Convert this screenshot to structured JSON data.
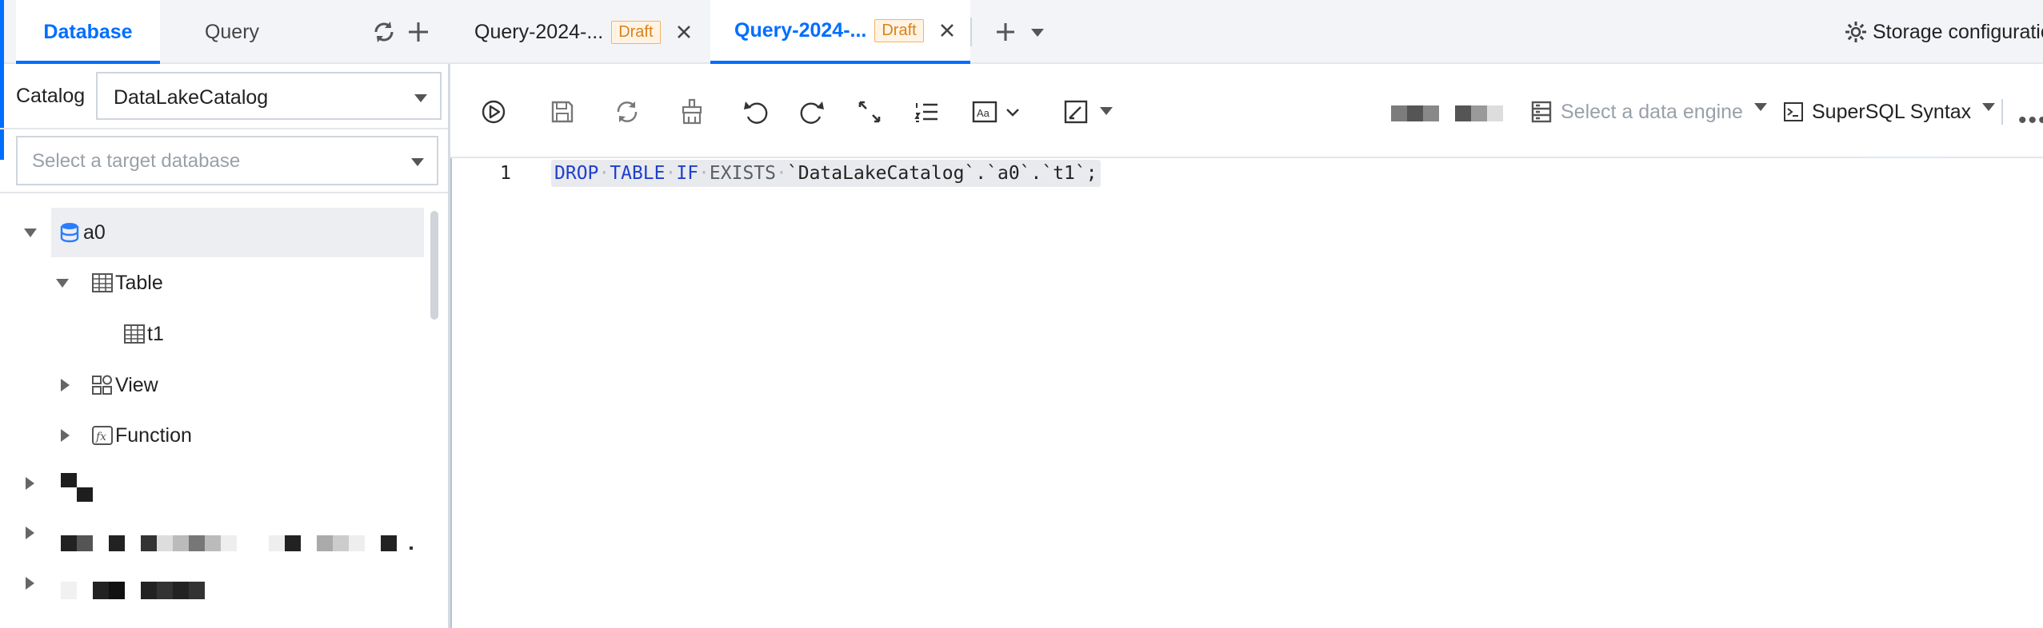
{
  "sidebar": {
    "tabs": [
      {
        "label": "Database",
        "active": true
      },
      {
        "label": "Query",
        "active": false
      }
    ],
    "catalog": {
      "label": "Catalog",
      "value": "DataLakeCatalog"
    },
    "database_select": {
      "placeholder": "Select a target database"
    },
    "tree": {
      "database": "a0",
      "table_group": "Table",
      "table": "t1",
      "view_group": "View",
      "function_group": "Function"
    }
  },
  "query_tabs": [
    {
      "title": "Query-2024-...",
      "badge": "Draft",
      "active": false
    },
    {
      "title": "Query-2024-...",
      "badge": "Draft",
      "active": true
    }
  ],
  "storage": {
    "label": "Storage configuratio"
  },
  "toolbar": {
    "engine_placeholder": "Select a data engine",
    "syntax_label": "SuperSQL Syntax"
  },
  "editor": {
    "line_number": "1",
    "tokens": {
      "drop": "DROP",
      "table": "TABLE",
      "if": "IF",
      "exists": "EXISTS",
      "target": "`DataLakeCatalog`.`a0`.`t1`;"
    }
  },
  "colors": {
    "accent": "#006eff",
    "draft_badge": "#d9821c",
    "keyword": "#1f3fcc"
  },
  "icons": {
    "sidebar": [
      "sync-icon",
      "plus-icon",
      "database-icon",
      "table-icon",
      "view-icon",
      "function-icon"
    ],
    "toolbar": [
      "run-icon",
      "save-icon",
      "refresh-icon",
      "clean-icon",
      "undo-icon",
      "redo-icon",
      "expand-icon",
      "list-icon",
      "font-icon",
      "format-icon",
      "engine-icon",
      "terminal-icon"
    ]
  }
}
